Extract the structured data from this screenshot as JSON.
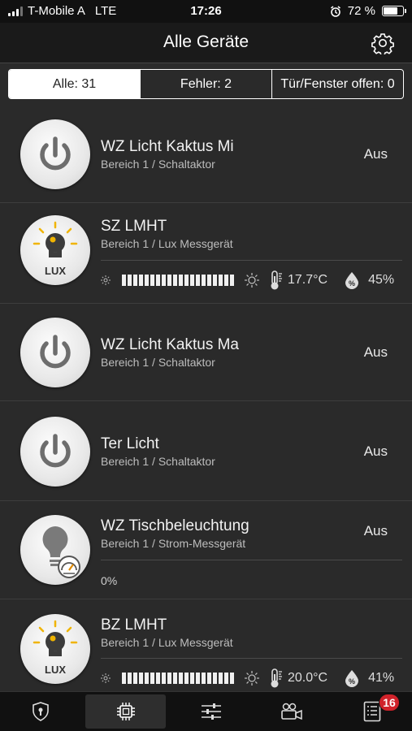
{
  "status_bar": {
    "carrier": "T-Mobile A",
    "network": "LTE",
    "time": "17:26",
    "battery": "72 %",
    "battery_level": 0.72
  },
  "header": {
    "title": "Alle Geräte"
  },
  "filter": {
    "all": "Alle: 31",
    "errors": "Fehler: 2",
    "open": "Tür/Fenster offen: 0"
  },
  "devices": [
    {
      "name": "WZ Licht Kaktus Mi",
      "area": "Bereich 1 / Schaltaktor",
      "state": "Aus",
      "icon": "power-icon"
    },
    {
      "name": "SZ LMHT",
      "area": "Bereich 1 / Lux Messgerät",
      "icon": "lux-sensor-icon",
      "lux_label": "LUX",
      "temp": "17.7°C",
      "humidity": "45%"
    },
    {
      "name": "WZ Licht Kaktus Ma",
      "area": "Bereich 1 / Schaltaktor",
      "state": "Aus",
      "icon": "power-icon"
    },
    {
      "name": "Ter Licht",
      "area": "Bereich 1 / Schaltaktor",
      "state": "Aus",
      "icon": "power-icon"
    },
    {
      "name": "WZ Tischbeleuchtung",
      "area": "Bereich 1 / Strom-Messgerät",
      "state": "Aus",
      "icon": "bulb-meter-icon",
      "value": "0%"
    },
    {
      "name": "BZ LMHT",
      "area": "Bereich 1 / Lux Messgerät",
      "icon": "lux-sensor-icon",
      "lux_label": "LUX",
      "temp": "20.0°C",
      "humidity": "41%"
    }
  ],
  "tabbar": {
    "messages_badge": "16"
  },
  "colors": {
    "background": "#2a2a2a",
    "badge": "#d0222a",
    "lux_yellow": "#f0b400"
  }
}
